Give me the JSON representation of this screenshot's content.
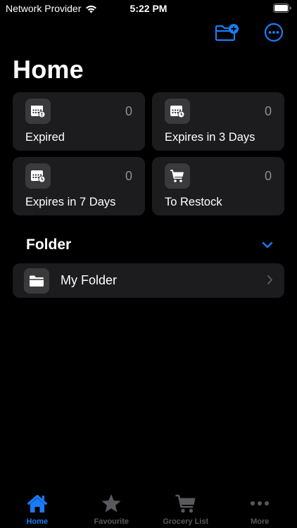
{
  "colors": {
    "accent": "#1a7cf5",
    "card_bg": "#1c1c1e",
    "icon_bg": "#3a3a3c",
    "muted": "#8e8e93",
    "tab_inactive": "#5a5a5e"
  },
  "status_bar": {
    "carrier": "Network Provider",
    "time": "5:22 PM",
    "icons": [
      "wifi-icon",
      "battery-icon"
    ]
  },
  "toolbar": {
    "actions": [
      "new-folder-icon",
      "ellipsis-circle-icon"
    ]
  },
  "page": {
    "title": "Home"
  },
  "summary_cards": [
    {
      "label": "Expired",
      "count": "0",
      "icon": "calendar-exclamation-icon"
    },
    {
      "label": "Expires in 3 Days",
      "count": "0",
      "icon": "calendar-clock-icon"
    },
    {
      "label": "Expires in 7 Days",
      "count": "0",
      "icon": "calendar-clock-icon"
    },
    {
      "label": "To Restock",
      "count": "0",
      "icon": "cart-icon"
    }
  ],
  "folder_section": {
    "title": "Folder",
    "toggle_icon": "chevron-down-icon",
    "items": [
      {
        "label": "My Folder",
        "icon": "folder-icon"
      }
    ]
  },
  "tab_bar": {
    "tabs": [
      {
        "label": "Home",
        "icon": "house-icon",
        "active": true
      },
      {
        "label": "Favourite",
        "icon": "star-icon",
        "active": false
      },
      {
        "label": "Grocery List",
        "icon": "cart-icon",
        "active": false
      },
      {
        "label": "More",
        "icon": "ellipsis-icon",
        "active": false
      }
    ]
  }
}
